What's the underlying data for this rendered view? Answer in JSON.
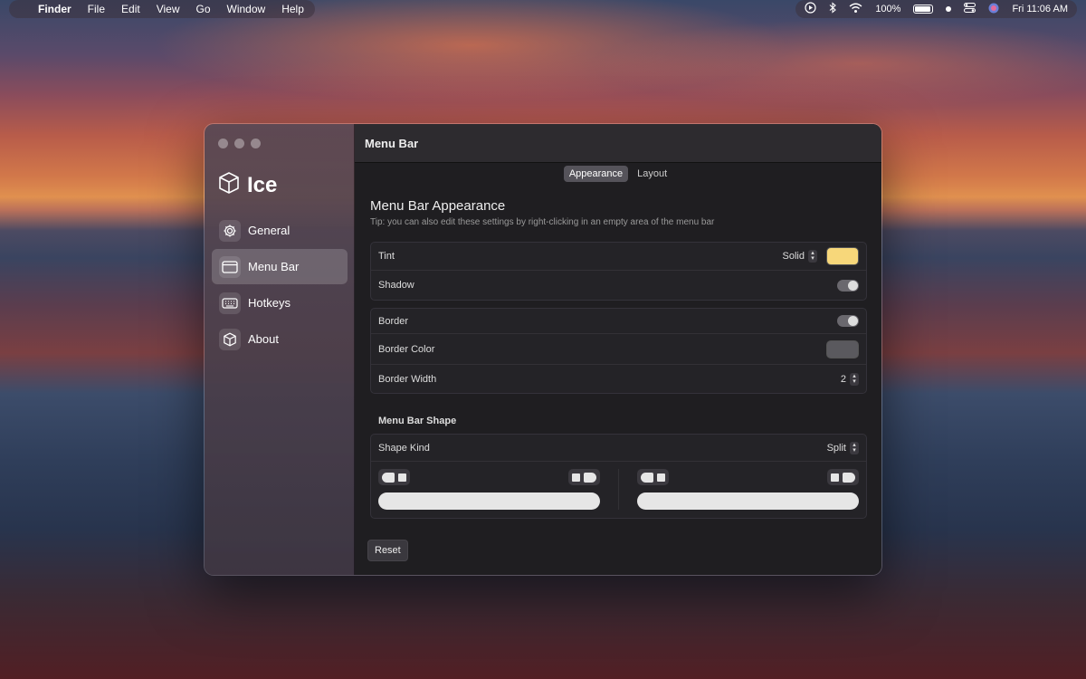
{
  "menubar": {
    "apple": "",
    "app_name": "Finder",
    "menus": [
      "File",
      "Edit",
      "View",
      "Go",
      "Window",
      "Help"
    ],
    "battery": "100%",
    "clock": "Fri 11:06 AM"
  },
  "sidebar": {
    "app_title": "Ice",
    "items": [
      {
        "label": "General",
        "icon": "gear-icon"
      },
      {
        "label": "Menu Bar",
        "icon": "menubar-icon"
      },
      {
        "label": "Hotkeys",
        "icon": "keyboard-icon"
      },
      {
        "label": "About",
        "icon": "cube-icon"
      }
    ],
    "active_index": 1
  },
  "main": {
    "header_title": "Menu Bar",
    "tabs": [
      {
        "label": "Appearance",
        "active": true
      },
      {
        "label": "Layout",
        "active": false
      }
    ],
    "section_title": "Menu Bar Appearance",
    "tip": "Tip: you can also edit these settings by right-clicking in an empty area of the menu bar",
    "tint": {
      "label": "Tint",
      "mode": "Solid",
      "color": "#f7d77a"
    },
    "shadow": {
      "label": "Shadow",
      "enabled": true
    },
    "border": {
      "label": "Border",
      "enabled": true
    },
    "border_color": {
      "label": "Border Color",
      "color": "#5a595e"
    },
    "border_width": {
      "label": "Border Width",
      "value": "2"
    },
    "shape_heading": "Menu Bar Shape",
    "shape_kind": {
      "label": "Shape Kind",
      "value": "Split"
    },
    "reset_label": "Reset"
  }
}
